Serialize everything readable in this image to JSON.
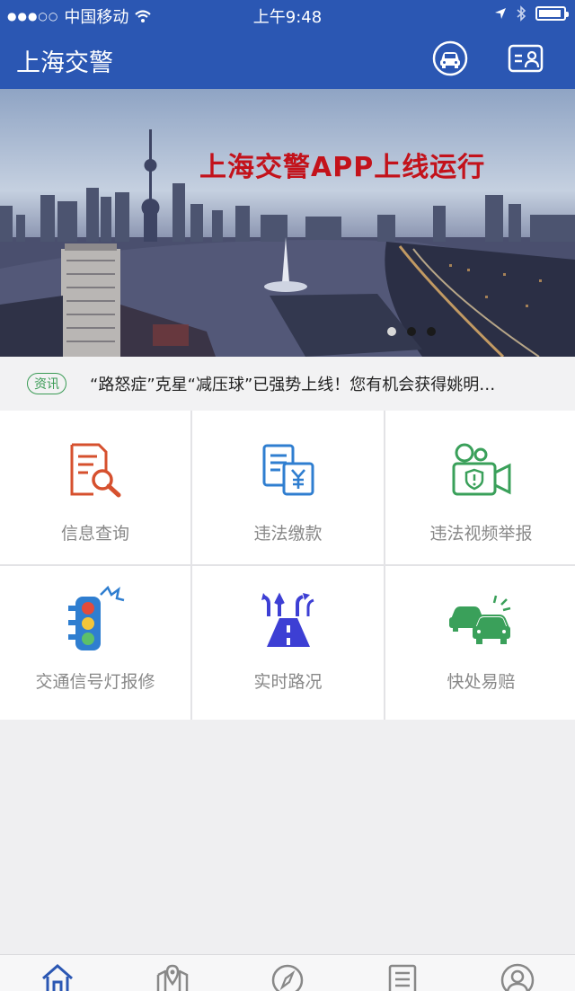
{
  "status_bar": {
    "carrier": "中国移动",
    "time": "上午9:48"
  },
  "nav": {
    "title": "上海交警",
    "icons": [
      "car-icon",
      "id-card-icon"
    ]
  },
  "banner": {
    "headline": "上海交警APP上线运行",
    "page_count": 3,
    "active_page": 1
  },
  "news": {
    "tag": "资讯",
    "text": "“路怒症”克星“减压球”已强势上线！您有机会获得姚明…"
  },
  "services": [
    {
      "label": "信息查询",
      "icon": "document-search-icon",
      "color": "#d6502e"
    },
    {
      "label": "违法缴款",
      "icon": "payment-bill-icon",
      "color": "#2f7ed0"
    },
    {
      "label": "违法视频举报",
      "icon": "video-camera-icon",
      "color": "#3aa05a"
    },
    {
      "label": "交通信号灯报修",
      "icon": "traffic-light-icon",
      "color": "#2f7ed0"
    },
    {
      "label": "实时路况",
      "icon": "road-icon",
      "color": "#3d3fd4"
    },
    {
      "label": "快处易赔",
      "icon": "car-accident-icon",
      "color": "#3aa05a"
    }
  ],
  "tabs": [
    {
      "icon": "home-icon",
      "active": true
    },
    {
      "icon": "map-pin-icon",
      "active": false
    },
    {
      "icon": "compass-icon",
      "active": false
    },
    {
      "icon": "list-icon",
      "active": false
    },
    {
      "icon": "user-icon",
      "active": false
    }
  ],
  "colors": {
    "primary": "#2b57b3",
    "headline": "#c3121b",
    "tag": "#3a9b55"
  }
}
